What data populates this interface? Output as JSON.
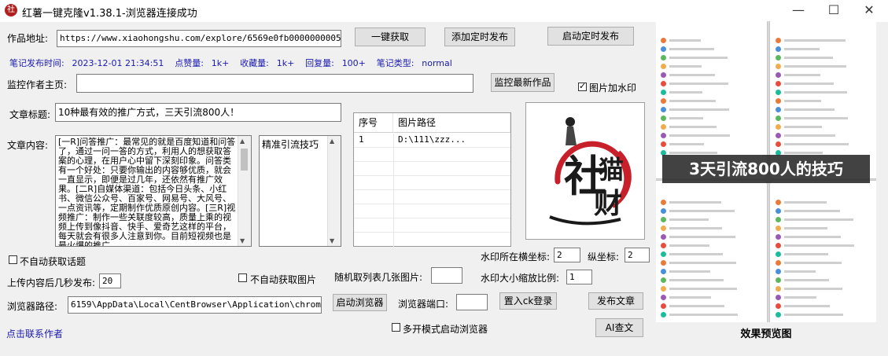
{
  "window": {
    "title": "红薯一键克隆v1.38.1-浏览器连接成功",
    "app_icon_text": "社"
  },
  "url": {
    "label": "作品地址:",
    "value": "https://www.xiaohongshu.com/explore/6569e0fb000000000503a2e2"
  },
  "buttons": {
    "fetch": "一键获取",
    "add_schedule": "添加定时发布",
    "start_schedule": "启动定时发布",
    "monitor_latest": "监控最新作品",
    "launch_browser": "启动浏览器",
    "ck_login": "置入ck登录",
    "publish": "发布文章",
    "ai_check": "AI查文"
  },
  "note_info": {
    "publish_time_label": "笔记发布时间:",
    "publish_time": "2023-12-01 21:34:51",
    "likes_label": "点赞量:",
    "likes": "1k+",
    "favorites_label": "收藏量:",
    "favorites": "1k+",
    "replies_label": "回复量:",
    "replies": "100+",
    "type_label": "笔记类型:",
    "type": "normal"
  },
  "monitor": {
    "label": "监控作者主页:",
    "value": ""
  },
  "watermark": {
    "label": "图片加水印",
    "checked": true,
    "logo_text_1": "社",
    "logo_text_2": "财",
    "logo_text_3": "猫"
  },
  "article": {
    "title_label": "文章标题:",
    "title": "10种最有效的推广方式，三天引流800人！",
    "content_label": "文章内容:",
    "content": "[一R]问答推广：最常见的就是百度知道和问答了，通过一问一答的方式，利用人的想获取答案的心理，在用户心中留下深刻印象。问答类有一个好处：只要你输出的内容够优质，就会一直显示，即便是过几年，还依然有推广效果。[二R]自媒体渠道：包括今日头条、小红书、微信公众号、百家号、网易号、大风号、一点资讯等，定期制作优质原创内容。[三R]视频推广：制作一些关联度较高，质量上乘的视频上传到像抖音、快手、爱奇艺这样的平台，每天就会有很多人注意到你。目前短视频也是最火爆的推广",
    "tags": "精准引流技巧"
  },
  "images_table": {
    "headers": [
      "序号",
      "图片路径"
    ],
    "rows": [
      {
        "index": "1",
        "path": "D:\\111\\zzz..."
      }
    ]
  },
  "options": {
    "no_auto_topic": "不自动获取话题",
    "no_auto_image": "不自动获取图片",
    "multi_browser": "多开模式启动浏览器"
  },
  "settings": {
    "upload_delay_label": "上传内容后几秒发布:",
    "upload_delay": "20",
    "random_images_label": "随机取列表几张图片:",
    "random_images": "",
    "wm_x_label": "水印所在横坐标:",
    "wm_x": "2",
    "wm_y_label": "纵坐标:",
    "wm_y": "2",
    "wm_scale_label": "水印大小缩放比例:",
    "wm_scale": "1",
    "browser_path_label": "浏览器路径:",
    "browser_path": "6159\\AppData\\Local\\CentBrowser\\Application\\chrome.exe",
    "browser_port_label": "浏览器端口:",
    "browser_port": ""
  },
  "preview": {
    "banner": "3天引流800人的技巧",
    "caption": "效果预览图"
  },
  "contact": {
    "label": "点击联系作者"
  },
  "colors": {
    "accent_blue": "#1a1ab0",
    "logo_red": "#c8202a"
  }
}
